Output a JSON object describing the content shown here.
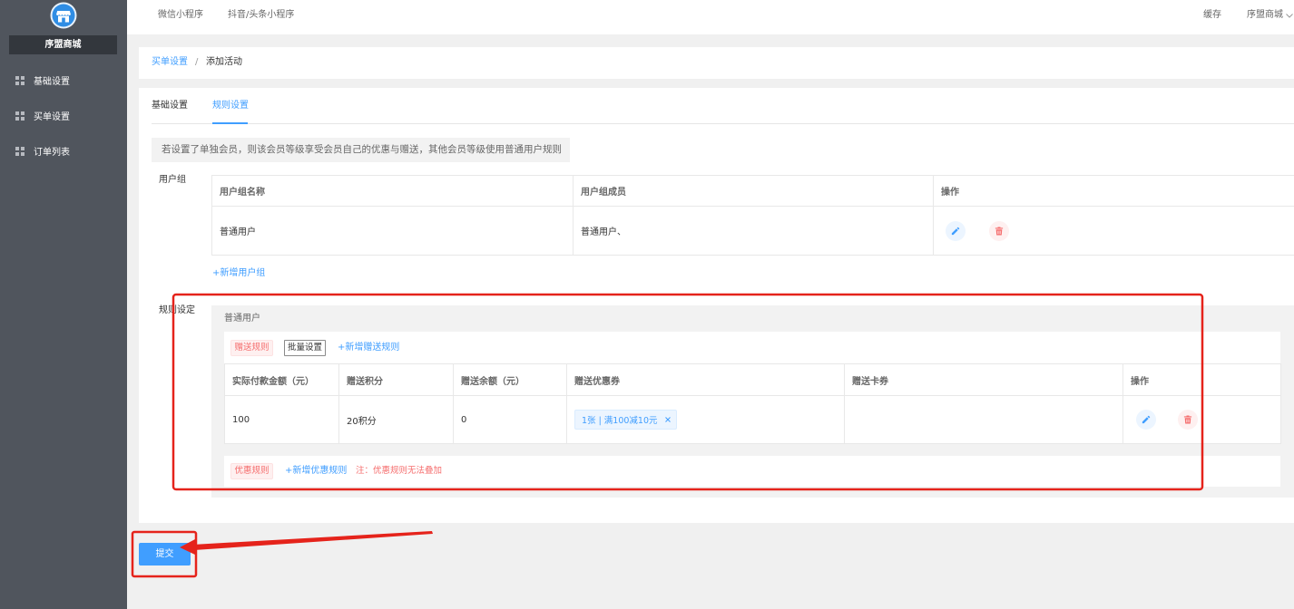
{
  "sidebar": {
    "logo_icon": "store-logo-icon",
    "brand": "序盟商城",
    "items": [
      {
        "label": "基础设置",
        "icon": "grid-icon"
      },
      {
        "label": "买单设置",
        "icon": "grid-icon"
      },
      {
        "label": "订单列表",
        "icon": "grid-icon"
      }
    ]
  },
  "header": {
    "nav": [
      {
        "label": "微信小程序"
      },
      {
        "label": "抖音/头条小程序"
      }
    ],
    "cache_label": "缓存",
    "account_label": "序盟商城",
    "account_icon": "chevron-down-icon"
  },
  "breadcrumb": {
    "parent": "买单设置",
    "separator": "/",
    "current": "添加活动"
  },
  "tabs": [
    {
      "label": "基础设置",
      "active": false
    },
    {
      "label": "规则设置",
      "active": true
    }
  ],
  "notice": "若设置了单独会员，则该会员等级享受会员自己的优惠与赠送，其他会员等级使用普通用户规则",
  "user_group": {
    "label": "用户组",
    "columns": [
      "用户组名称",
      "用户组成员",
      "操作"
    ],
    "rows": [
      {
        "name": "普通用户",
        "members": "普通用户、",
        "actions": [
          "edit-icon",
          "delete-icon"
        ]
      }
    ],
    "add_label": "+新增用户组"
  },
  "rules": {
    "label": "规则设定",
    "group_name": "普通用户",
    "gift": {
      "tag": "赠送规则",
      "batch_label": "批量设置",
      "add_label": "+新增赠送规则",
      "columns": [
        "实际付款金额（元）",
        "赠送积分",
        "赠送余额（元）",
        "赠送优惠券",
        "赠送卡券",
        "操作"
      ],
      "rows": [
        {
          "amount": "100",
          "points": "20积分",
          "balance": "0",
          "coupons": [
            "1张 | 满100减10元"
          ],
          "actions": [
            "edit-icon",
            "delete-icon"
          ]
        }
      ]
    },
    "discount": {
      "tag": "优惠规则",
      "add_label": "+新增优惠规则",
      "note": "注：优惠规则无法叠加"
    }
  },
  "submit_label": "提交",
  "colors": {
    "accent": "#409eff",
    "danger": "#f56c6c",
    "sidebar_bg": "#50555d",
    "annotation": "#e5231b"
  }
}
